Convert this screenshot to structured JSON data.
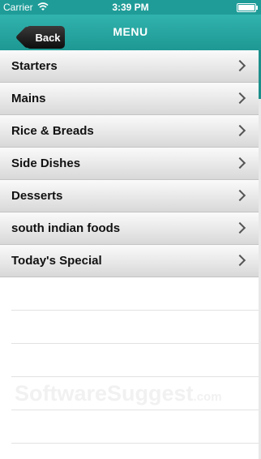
{
  "status_bar": {
    "carrier": "Carrier",
    "time": "3:39 PM"
  },
  "nav": {
    "back_label": "Back",
    "title": "MENU"
  },
  "menu_items": [
    {
      "label": "Starters"
    },
    {
      "label": "Mains"
    },
    {
      "label": "Rice & Breads"
    },
    {
      "label": "Side Dishes"
    },
    {
      "label": "Desserts"
    },
    {
      "label": "south indian foods"
    },
    {
      "label": "Today's Special"
    }
  ],
  "watermark": {
    "text": "SoftwareSuggest",
    "suffix": ".com"
  },
  "colors": {
    "accent": "#1f9c98",
    "back_button": "#1a1a1a"
  },
  "icons": [
    "wifi-icon",
    "battery-icon",
    "chevron-right-icon"
  ]
}
